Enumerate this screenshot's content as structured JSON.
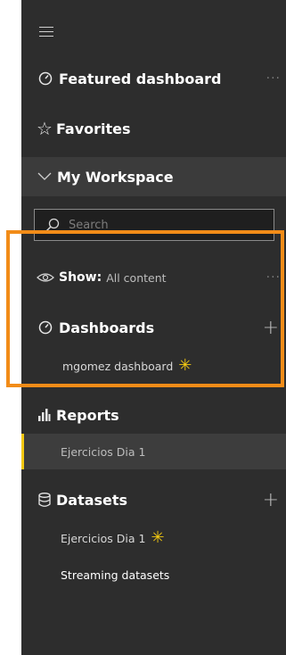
{
  "nav": {
    "featured": {
      "label": "Featured dashboard",
      "more": "···"
    },
    "favorites": {
      "label": "Favorites"
    },
    "workspace": {
      "label": "My Workspace"
    },
    "search": {
      "placeholder": "Search"
    },
    "show": {
      "label": "Show:",
      "value": "All content",
      "more": "···"
    },
    "dashboards": {
      "label": "Dashboards",
      "add": "+",
      "items": [
        {
          "label": "mgomez dashboard",
          "new_badge": "✳"
        }
      ]
    },
    "reports": {
      "label": "Reports",
      "items": [
        {
          "label": "Ejercicios Dia 1"
        }
      ]
    },
    "datasets": {
      "label": "Datasets",
      "add": "+",
      "items": [
        {
          "label": "Ejercicios Dia 1",
          "new_badge": "✳"
        },
        {
          "label": "Streaming datasets"
        }
      ]
    }
  },
  "colors": {
    "nav_bg": "#2d2d2d",
    "accent": "#f2c811",
    "highlight": "#f28c18"
  }
}
